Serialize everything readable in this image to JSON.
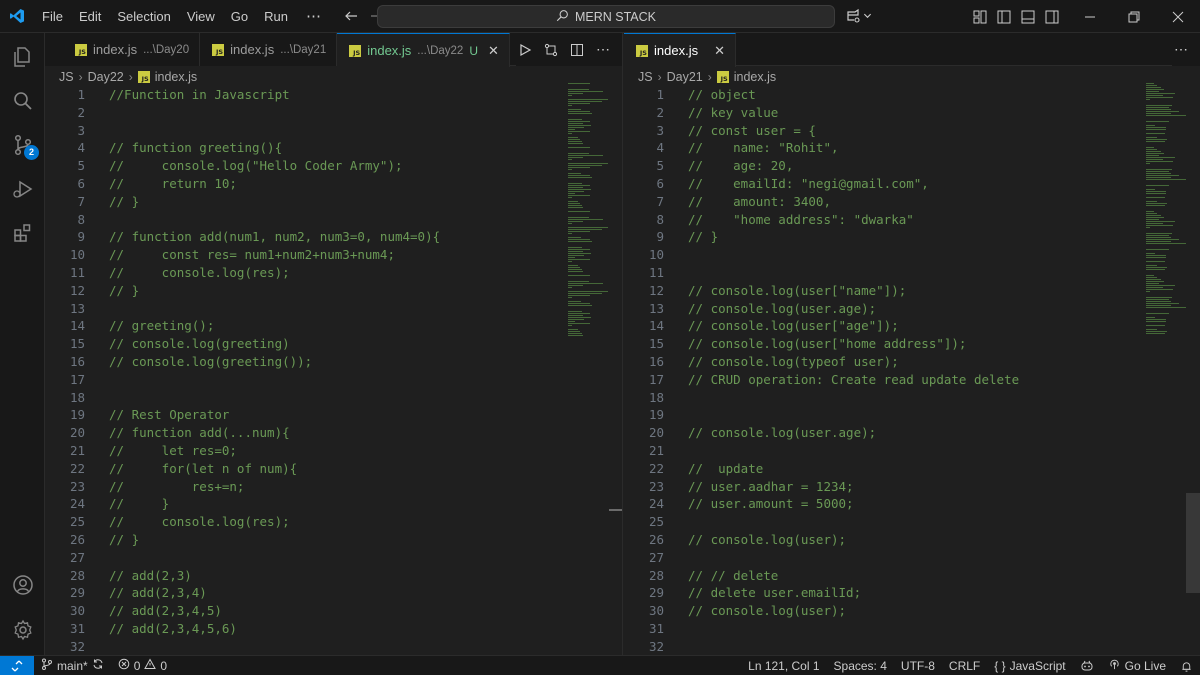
{
  "titlebar": {
    "menu": [
      "File",
      "Edit",
      "Selection",
      "View",
      "Go",
      "Run"
    ],
    "more": "⋯",
    "search_text": "MERN STACK"
  },
  "activity": {
    "scm_badge": "2"
  },
  "left": {
    "tabs": [
      {
        "name": "index.js",
        "desc": "...\\Day20",
        "active": false
      },
      {
        "name": "index.js",
        "desc": "...\\Day21",
        "active": false
      },
      {
        "name": "index.js",
        "desc": "...\\Day22",
        "status": "U",
        "active": true
      }
    ],
    "breadcrumb": [
      "JS",
      "Day22",
      "index.js"
    ],
    "lines": [
      "//Function in Javascript",
      "",
      "",
      "// function greeting(){",
      "//     console.log(\"Hello Coder Army\");",
      "//     return 10;",
      "// }",
      "",
      "// function add(num1, num2, num3=0, num4=0){",
      "//     const res= num1+num2+num3+num4;",
      "//     console.log(res);",
      "// }",
      "",
      "// greeting();",
      "// console.log(greeting)",
      "// console.log(greeting());",
      "",
      "",
      "// Rest Operator",
      "// function add(...num){",
      "//     let res=0;",
      "//     for(let n of num){",
      "//         res+=n;",
      "//     }",
      "//     console.log(res);",
      "// }",
      "",
      "// add(2,3)",
      "// add(2,3,4)",
      "// add(2,3,4,5)",
      "// add(2,3,4,5,6)",
      ""
    ]
  },
  "right": {
    "tabs": [
      {
        "name": "index.js",
        "active": true
      }
    ],
    "breadcrumb": [
      "JS",
      "Day21",
      "index.js"
    ],
    "lines": [
      "// object",
      "// key value",
      "// const user = {",
      "//    name: \"Rohit\",",
      "//    age: 20,",
      "//    emailId: \"negi@gmail.com\",",
      "//    amount: 3400,",
      "//    \"home address\": \"dwarka\"",
      "// }",
      "",
      "",
      "// console.log(user[\"name\"]);",
      "// console.log(user.age);",
      "// console.log(user[\"age\"]);",
      "// console.log(user[\"home address\"]);",
      "// console.log(typeof user);",
      "// CRUD operation: Create read update delete",
      "",
      "",
      "// console.log(user.age);",
      "",
      "//  update",
      "// user.aadhar = 1234;",
      "// user.amount = 5000;",
      "",
      "// console.log(user);",
      "",
      "// // delete",
      "// delete user.emailId;",
      "// console.log(user);",
      "",
      ""
    ]
  },
  "status": {
    "branch": "main*",
    "errors": "0",
    "warnings": "0",
    "position": "Ln 121, Col 1",
    "spaces": "Spaces: 4",
    "encoding": "UTF-8",
    "eol": "CRLF",
    "language": "JavaScript",
    "golive": "Go Live"
  },
  "colors": {
    "comment": "#6a9955",
    "accent": "#0078d4",
    "background": "#1f1f1f"
  }
}
